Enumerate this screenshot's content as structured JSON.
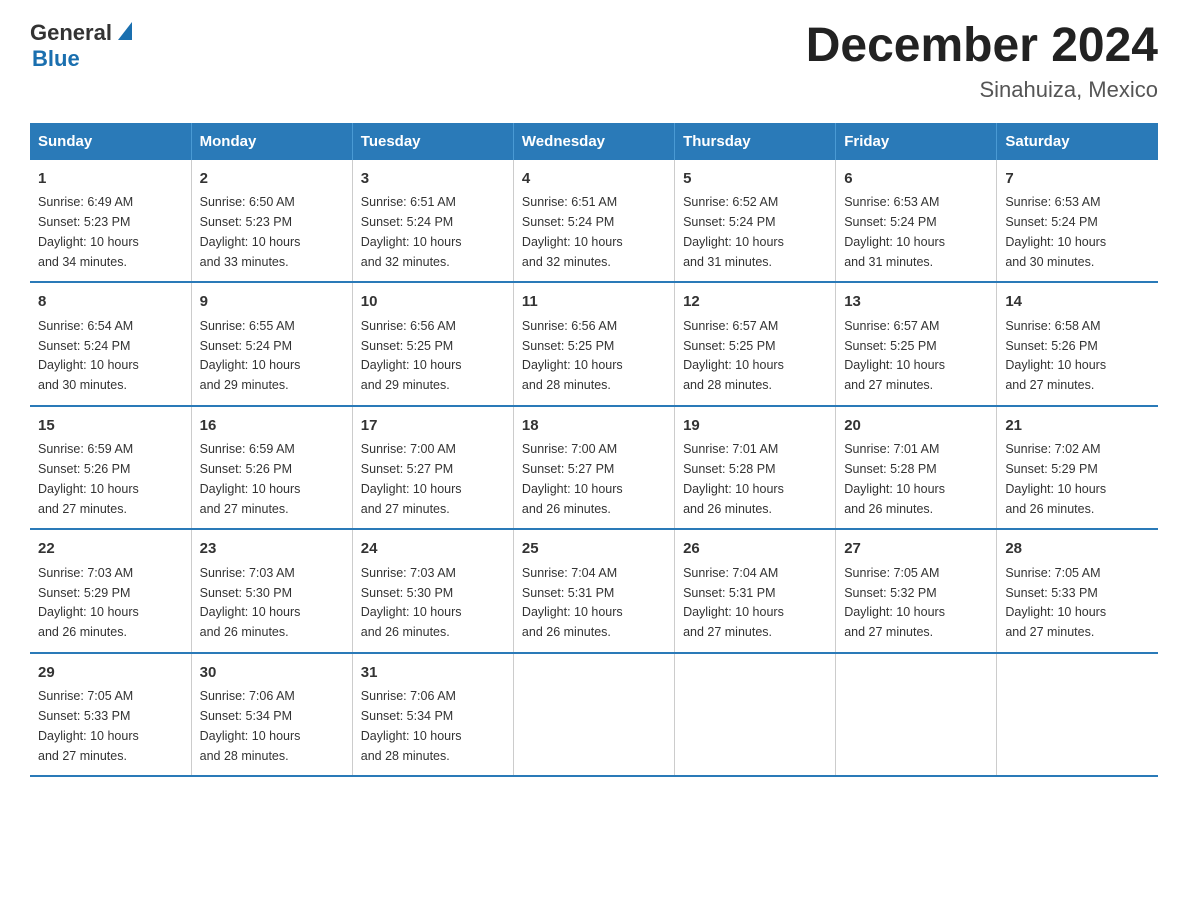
{
  "logo": {
    "general": "General",
    "blue": "Blue"
  },
  "header": {
    "month": "December 2024",
    "location": "Sinahuiza, Mexico"
  },
  "days_of_week": [
    "Sunday",
    "Monday",
    "Tuesday",
    "Wednesday",
    "Thursday",
    "Friday",
    "Saturday"
  ],
  "weeks": [
    [
      {
        "day": "1",
        "sunrise": "6:49 AM",
        "sunset": "5:23 PM",
        "daylight": "10 hours and 34 minutes."
      },
      {
        "day": "2",
        "sunrise": "6:50 AM",
        "sunset": "5:23 PM",
        "daylight": "10 hours and 33 minutes."
      },
      {
        "day": "3",
        "sunrise": "6:51 AM",
        "sunset": "5:24 PM",
        "daylight": "10 hours and 32 minutes."
      },
      {
        "day": "4",
        "sunrise": "6:51 AM",
        "sunset": "5:24 PM",
        "daylight": "10 hours and 32 minutes."
      },
      {
        "day": "5",
        "sunrise": "6:52 AM",
        "sunset": "5:24 PM",
        "daylight": "10 hours and 31 minutes."
      },
      {
        "day": "6",
        "sunrise": "6:53 AM",
        "sunset": "5:24 PM",
        "daylight": "10 hours and 31 minutes."
      },
      {
        "day": "7",
        "sunrise": "6:53 AM",
        "sunset": "5:24 PM",
        "daylight": "10 hours and 30 minutes."
      }
    ],
    [
      {
        "day": "8",
        "sunrise": "6:54 AM",
        "sunset": "5:24 PM",
        "daylight": "10 hours and 30 minutes."
      },
      {
        "day": "9",
        "sunrise": "6:55 AM",
        "sunset": "5:24 PM",
        "daylight": "10 hours and 29 minutes."
      },
      {
        "day": "10",
        "sunrise": "6:56 AM",
        "sunset": "5:25 PM",
        "daylight": "10 hours and 29 minutes."
      },
      {
        "day": "11",
        "sunrise": "6:56 AM",
        "sunset": "5:25 PM",
        "daylight": "10 hours and 28 minutes."
      },
      {
        "day": "12",
        "sunrise": "6:57 AM",
        "sunset": "5:25 PM",
        "daylight": "10 hours and 28 minutes."
      },
      {
        "day": "13",
        "sunrise": "6:57 AM",
        "sunset": "5:25 PM",
        "daylight": "10 hours and 27 minutes."
      },
      {
        "day": "14",
        "sunrise": "6:58 AM",
        "sunset": "5:26 PM",
        "daylight": "10 hours and 27 minutes."
      }
    ],
    [
      {
        "day": "15",
        "sunrise": "6:59 AM",
        "sunset": "5:26 PM",
        "daylight": "10 hours and 27 minutes."
      },
      {
        "day": "16",
        "sunrise": "6:59 AM",
        "sunset": "5:26 PM",
        "daylight": "10 hours and 27 minutes."
      },
      {
        "day": "17",
        "sunrise": "7:00 AM",
        "sunset": "5:27 PM",
        "daylight": "10 hours and 27 minutes."
      },
      {
        "day": "18",
        "sunrise": "7:00 AM",
        "sunset": "5:27 PM",
        "daylight": "10 hours and 26 minutes."
      },
      {
        "day": "19",
        "sunrise": "7:01 AM",
        "sunset": "5:28 PM",
        "daylight": "10 hours and 26 minutes."
      },
      {
        "day": "20",
        "sunrise": "7:01 AM",
        "sunset": "5:28 PM",
        "daylight": "10 hours and 26 minutes."
      },
      {
        "day": "21",
        "sunrise": "7:02 AM",
        "sunset": "5:29 PM",
        "daylight": "10 hours and 26 minutes."
      }
    ],
    [
      {
        "day": "22",
        "sunrise": "7:03 AM",
        "sunset": "5:29 PM",
        "daylight": "10 hours and 26 minutes."
      },
      {
        "day": "23",
        "sunrise": "7:03 AM",
        "sunset": "5:30 PM",
        "daylight": "10 hours and 26 minutes."
      },
      {
        "day": "24",
        "sunrise": "7:03 AM",
        "sunset": "5:30 PM",
        "daylight": "10 hours and 26 minutes."
      },
      {
        "day": "25",
        "sunrise": "7:04 AM",
        "sunset": "5:31 PM",
        "daylight": "10 hours and 26 minutes."
      },
      {
        "day": "26",
        "sunrise": "7:04 AM",
        "sunset": "5:31 PM",
        "daylight": "10 hours and 27 minutes."
      },
      {
        "day": "27",
        "sunrise": "7:05 AM",
        "sunset": "5:32 PM",
        "daylight": "10 hours and 27 minutes."
      },
      {
        "day": "28",
        "sunrise": "7:05 AM",
        "sunset": "5:33 PM",
        "daylight": "10 hours and 27 minutes."
      }
    ],
    [
      {
        "day": "29",
        "sunrise": "7:05 AM",
        "sunset": "5:33 PM",
        "daylight": "10 hours and 27 minutes."
      },
      {
        "day": "30",
        "sunrise": "7:06 AM",
        "sunset": "5:34 PM",
        "daylight": "10 hours and 28 minutes."
      },
      {
        "day": "31",
        "sunrise": "7:06 AM",
        "sunset": "5:34 PM",
        "daylight": "10 hours and 28 minutes."
      },
      null,
      null,
      null,
      null
    ]
  ],
  "labels": {
    "sunrise": "Sunrise:",
    "sunset": "Sunset:",
    "daylight": "Daylight:"
  }
}
